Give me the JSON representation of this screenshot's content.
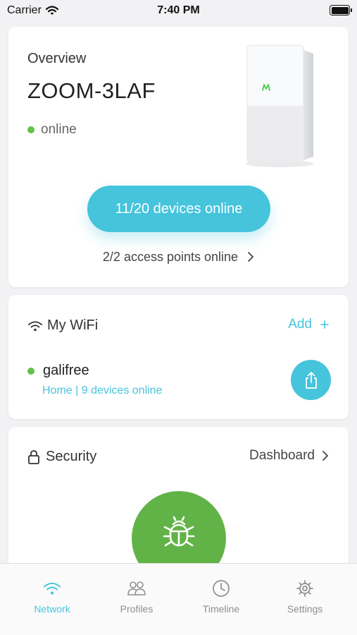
{
  "status_bar": {
    "carrier": "Carrier",
    "time": "7:40 PM"
  },
  "overview": {
    "label": "Overview",
    "network_name": "ZOOM-3LAF",
    "status": "online",
    "devices_button": "11/20 devices online",
    "access_points": "2/2 access points online"
  },
  "wifi": {
    "title": "My WiFi",
    "add_label": "Add",
    "network": {
      "ssid": "galifree",
      "detail": "Home | 9 devices online"
    }
  },
  "security": {
    "title": "Security",
    "dashboard_label": "Dashboard"
  },
  "tabs": [
    {
      "label": "Network",
      "icon": "wifi-icon",
      "active": true
    },
    {
      "label": "Profiles",
      "icon": "profiles-icon",
      "active": false
    },
    {
      "label": "Timeline",
      "icon": "clock-icon",
      "active": false
    },
    {
      "label": "Settings",
      "icon": "gear-icon",
      "active": false
    }
  ],
  "colors": {
    "accent": "#45c4dc",
    "online_green": "#62c14a",
    "security_green": "#62b347"
  }
}
